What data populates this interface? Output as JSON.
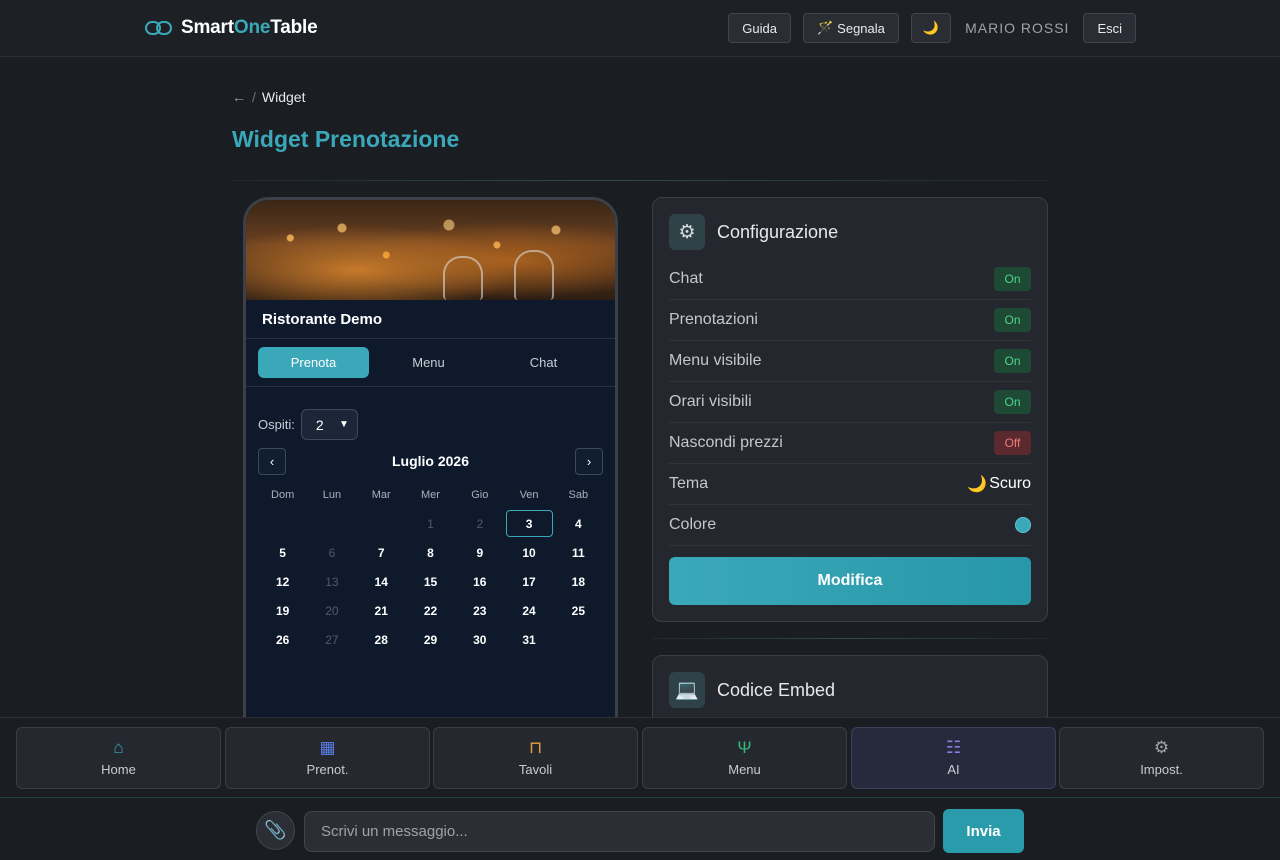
{
  "brand": {
    "part1": "Smart",
    "part2": "One",
    "part3": "Table",
    "accent": "#3aa8b8"
  },
  "topbar": {
    "guide_label": "Guida",
    "report_icon": "🪄",
    "report_label": "Segnala",
    "theme_toggle_icon": "🌙",
    "user_name": "MARIO ROSSI",
    "logout_label": "Esci"
  },
  "breadcrumb": {
    "back_icon": "←",
    "separator": "/",
    "current": "Widget"
  },
  "page": {
    "title": "Widget Prenotazione"
  },
  "widget_preview": {
    "restaurant_name": "Ristorante Demo",
    "tabs": [
      {
        "label": "Prenota",
        "active": true
      },
      {
        "label": "Menu",
        "active": false
      },
      {
        "label": "Chat",
        "active": false
      }
    ],
    "guests_label": "Ospiti:",
    "guests_value": "2",
    "calendar": {
      "month_label": "Luglio 2026",
      "prev_icon": "‹",
      "next_icon": "›",
      "weekdays": [
        "Dom",
        "Lun",
        "Mar",
        "Mer",
        "Gio",
        "Ven",
        "Sab"
      ],
      "days": [
        {
          "n": "",
          "s": "empty"
        },
        {
          "n": "",
          "s": "empty"
        },
        {
          "n": "",
          "s": "empty"
        },
        {
          "n": "1",
          "s": "muted"
        },
        {
          "n": "2",
          "s": "muted"
        },
        {
          "n": "3",
          "s": "sel"
        },
        {
          "n": "4",
          "s": "av"
        },
        {
          "n": "5",
          "s": "av"
        },
        {
          "n": "6",
          "s": "muted"
        },
        {
          "n": "7",
          "s": "av"
        },
        {
          "n": "8",
          "s": "av"
        },
        {
          "n": "9",
          "s": "av"
        },
        {
          "n": "10",
          "s": "av"
        },
        {
          "n": "11",
          "s": "av"
        },
        {
          "n": "12",
          "s": "av"
        },
        {
          "n": "13",
          "s": "muted"
        },
        {
          "n": "14",
          "s": "av"
        },
        {
          "n": "15",
          "s": "av"
        },
        {
          "n": "16",
          "s": "av"
        },
        {
          "n": "17",
          "s": "av"
        },
        {
          "n": "18",
          "s": "av"
        },
        {
          "n": "19",
          "s": "av"
        },
        {
          "n": "20",
          "s": "muted"
        },
        {
          "n": "21",
          "s": "av"
        },
        {
          "n": "22",
          "s": "av"
        },
        {
          "n": "23",
          "s": "av"
        },
        {
          "n": "24",
          "s": "av"
        },
        {
          "n": "25",
          "s": "av"
        },
        {
          "n": "26",
          "s": "av"
        },
        {
          "n": "27",
          "s": "muted"
        },
        {
          "n": "28",
          "s": "av"
        },
        {
          "n": "29",
          "s": "av"
        },
        {
          "n": "30",
          "s": "av"
        },
        {
          "n": "31",
          "s": "av"
        }
      ]
    }
  },
  "config": {
    "icon": "⚙",
    "title": "Configurazione",
    "rows": [
      {
        "label": "Chat",
        "value": "On",
        "state": "on"
      },
      {
        "label": "Prenotazioni",
        "value": "On",
        "state": "on"
      },
      {
        "label": "Menu visibile",
        "value": "On",
        "state": "on"
      },
      {
        "label": "Orari visibili",
        "value": "On",
        "state": "on"
      },
      {
        "label": "Nascondi prezzi",
        "value": "Off",
        "state": "off"
      }
    ],
    "theme_label": "Tema",
    "theme_icon": "🌙",
    "theme_value": "Scuro",
    "color_label": "Colore",
    "color_value": "#3aa8b8",
    "modify_label": "Modifica"
  },
  "embed": {
    "icon": "💻",
    "title": "Codice Embed"
  },
  "bottom_nav": [
    {
      "label": "Home",
      "icon": "⌂",
      "icon_name": "home-icon",
      "cls": "i-home"
    },
    {
      "label": "Prenot.",
      "icon": "▦",
      "icon_name": "calendar-icon",
      "cls": "i-cal"
    },
    {
      "label": "Tavoli",
      "icon": "⊓",
      "icon_name": "table-icon",
      "cls": "i-tab"
    },
    {
      "label": "Menu",
      "icon": "Ψ",
      "icon_name": "fork-knife-icon",
      "cls": "i-menu"
    },
    {
      "label": "AI",
      "icon": "☷",
      "icon_name": "robot-icon",
      "cls": "i-ai"
    },
    {
      "label": "Impost.",
      "icon": "⚙",
      "icon_name": "settings-icon",
      "cls": "i-set"
    }
  ],
  "chat": {
    "attach_icon": "📎",
    "placeholder": "Scrivi un messaggio...",
    "send_label": "Invia"
  }
}
